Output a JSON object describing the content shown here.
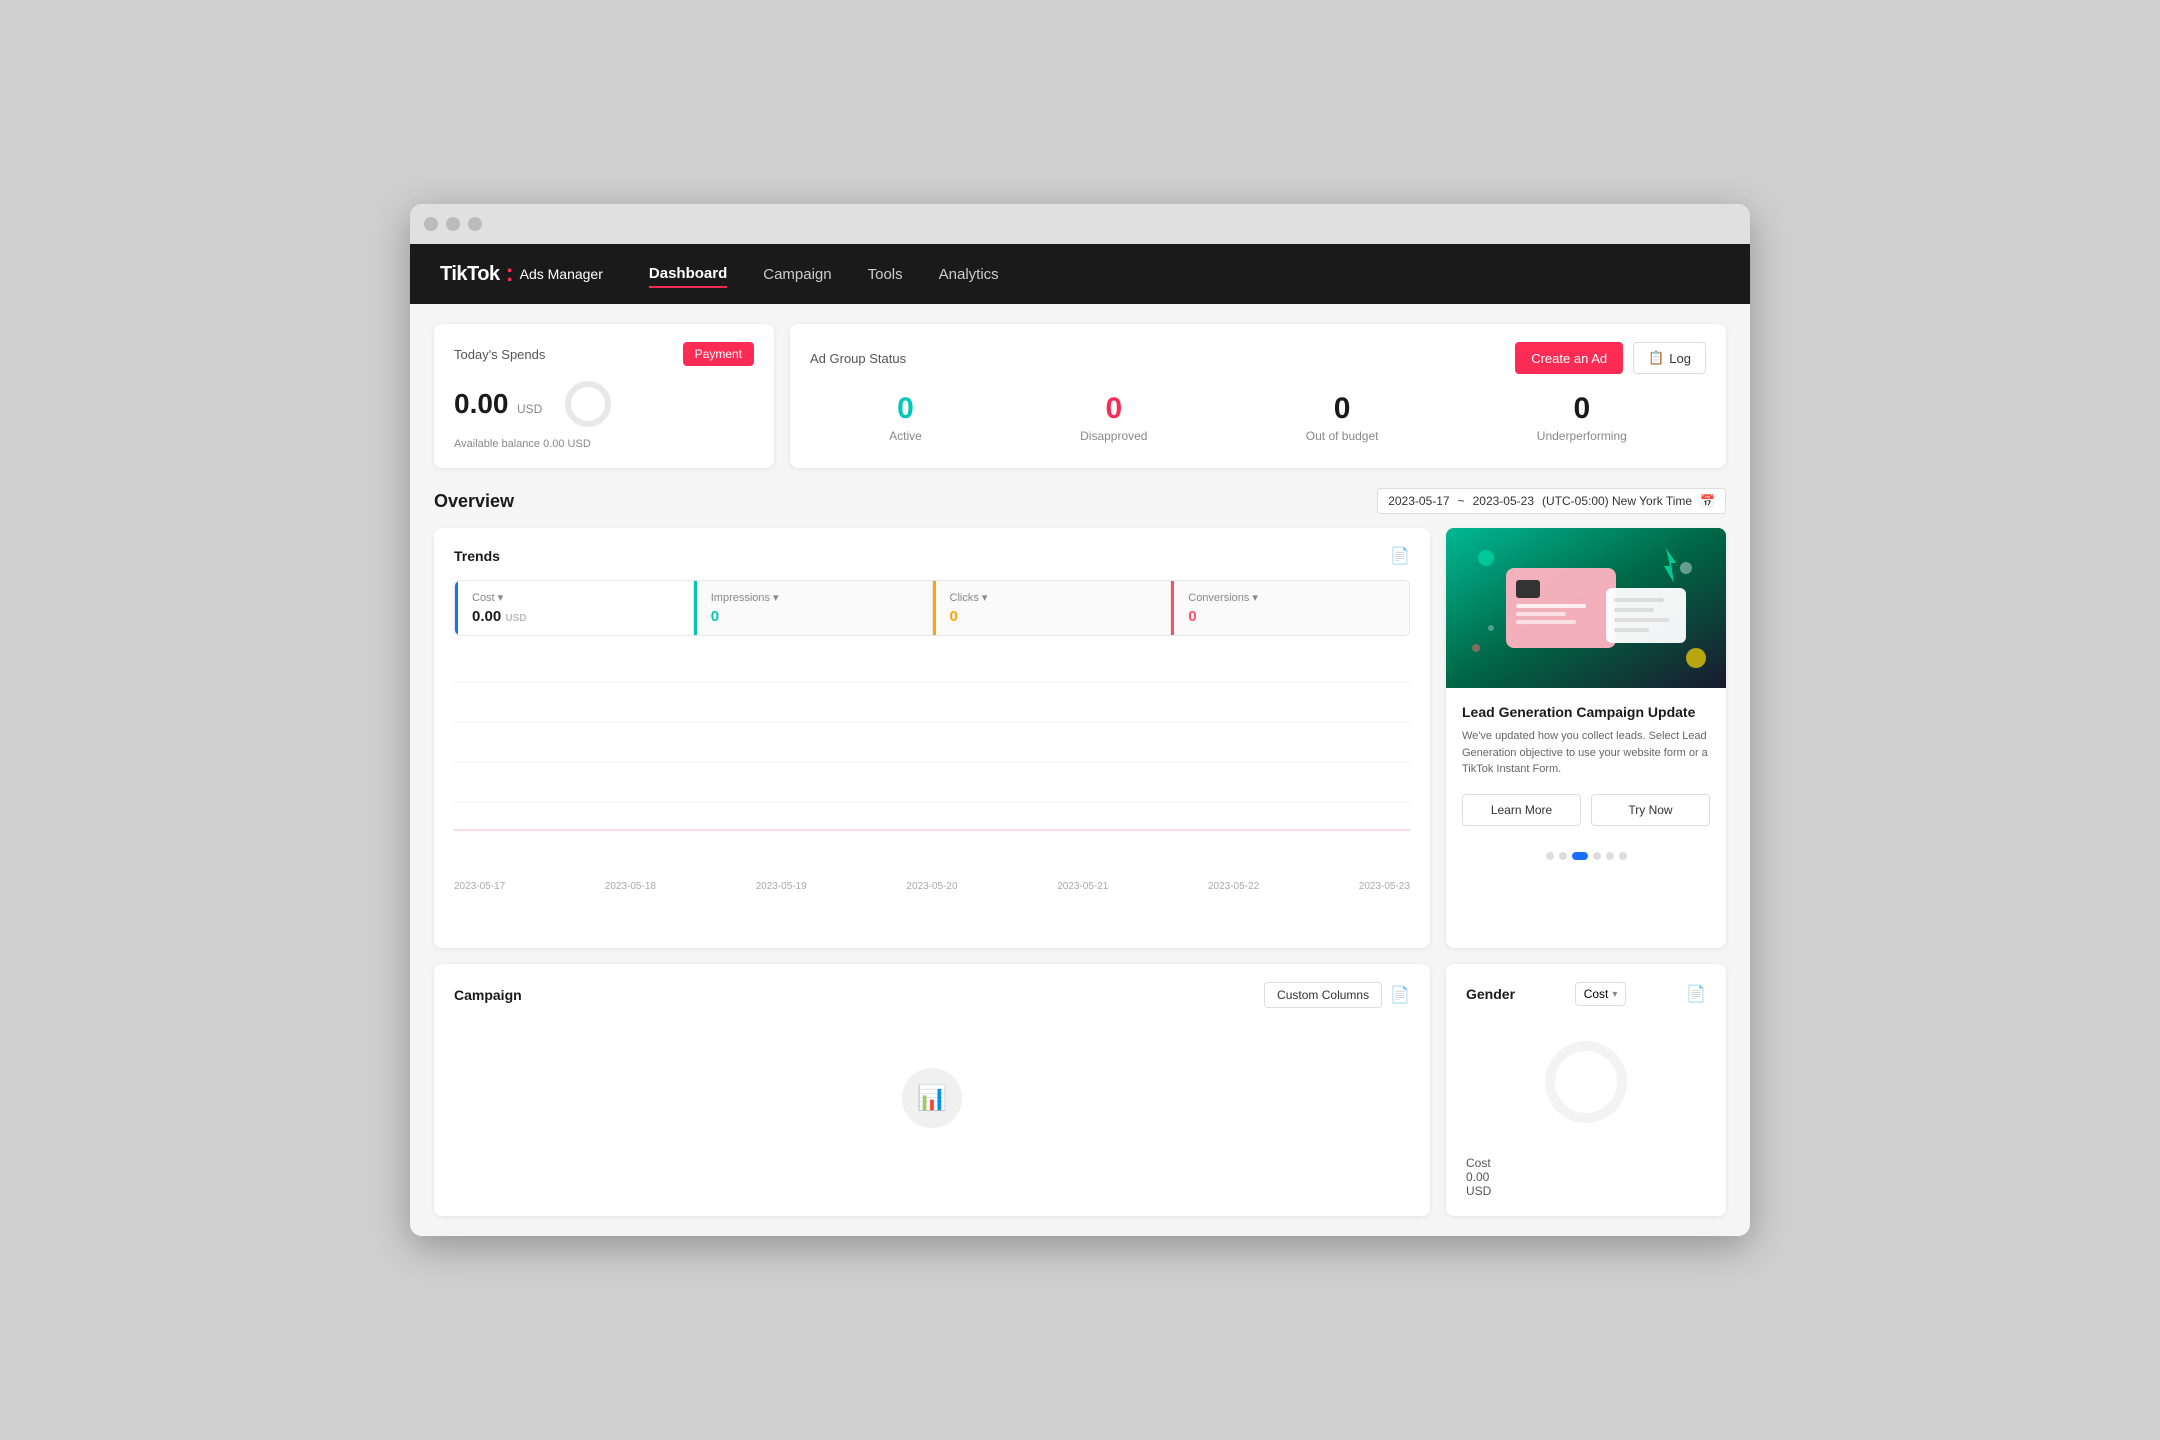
{
  "window": {
    "title": "TikTok Ads Manager"
  },
  "nav": {
    "logo": "TikTok",
    "logo_dot": ":",
    "logo_sub": "Ads Manager",
    "items": [
      {
        "label": "Dashboard",
        "active": true
      },
      {
        "label": "Campaign",
        "active": false
      },
      {
        "label": "Tools",
        "active": false
      },
      {
        "label": "Analytics",
        "active": false
      }
    ]
  },
  "spends": {
    "title": "Today's Spends",
    "payment_btn": "Payment",
    "amount": "0.00",
    "currency": "USD",
    "balance_label": "Available balance 0.00 USD"
  },
  "ad_group": {
    "title": "Ad Group Status",
    "create_btn": "Create an Ad",
    "log_btn": "Log",
    "statuses": [
      {
        "label": "Active",
        "value": "0",
        "color": "cyan"
      },
      {
        "label": "Disapproved",
        "value": "0",
        "color": "red"
      },
      {
        "label": "Out of budget",
        "value": "0",
        "color": "dark"
      },
      {
        "label": "Underperforming",
        "value": "0",
        "color": "dark"
      }
    ]
  },
  "overview": {
    "title": "Overview",
    "date_start": "2023-05-17",
    "date_separator": "~",
    "date_end": "2023-05-23",
    "timezone": "(UTC-05:00) New York Time"
  },
  "trends": {
    "title": "Trends",
    "metrics": [
      {
        "label": "Cost",
        "value": "0.00",
        "sub": "USD",
        "color": "dark",
        "border": "#1a6fff"
      },
      {
        "label": "Impressions",
        "value": "0",
        "sub": "",
        "color": "cyan",
        "border": "#00c8b4"
      },
      {
        "label": "Clicks",
        "value": "0",
        "sub": "",
        "color": "yellow",
        "border": "#ffa500"
      },
      {
        "label": "Conversions",
        "value": "0",
        "sub": "",
        "color": "pink",
        "border": "#ff4d6a"
      }
    ],
    "xaxis": [
      "2023-05-17",
      "2023-05-18",
      "2023-05-19",
      "2023-05-20",
      "2023-05-21",
      "2023-05-22",
      "2023-05-23"
    ]
  },
  "promo": {
    "title": "Lead Generation Campaign Update",
    "description": "We've updated how you collect leads. Select Lead Generation objective to use your website form or a TikTok Instant Form.",
    "learn_more_btn": "Learn More",
    "try_now_btn": "Try Now",
    "dots": [
      {
        "active": false
      },
      {
        "active": false
      },
      {
        "active": true
      },
      {
        "active": false
      },
      {
        "active": false
      },
      {
        "active": false
      }
    ]
  },
  "campaign": {
    "title": "Campaign",
    "custom_columns_btn": "Custom Columns"
  },
  "gender": {
    "title": "Gender",
    "cost_label": "Cost",
    "cost_value": "0.00",
    "currency": "USD",
    "cost_dropdown": "Cost"
  }
}
